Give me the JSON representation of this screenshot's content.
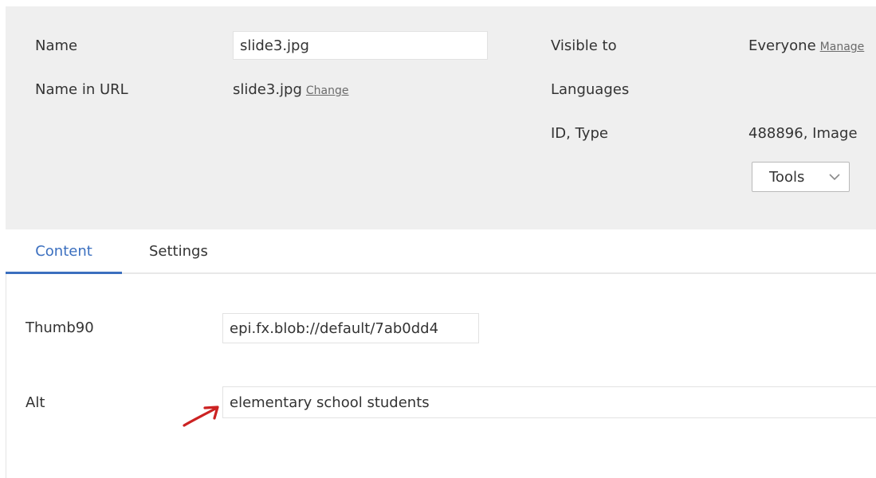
{
  "header": {
    "name_label": "Name",
    "name_value": "slide3.jpg",
    "name_in_url_label": "Name in URL",
    "name_in_url_value": "slide3.jpg",
    "change_link": "Change",
    "visible_to_label": "Visible to",
    "visible_to_value": "Everyone",
    "manage_link": "Manage",
    "languages_label": "Languages",
    "id_type_label": "ID, Type",
    "id_type_value": "488896, Image",
    "tools_label": "Tools"
  },
  "tabs": [
    {
      "label": "Content",
      "active": true
    },
    {
      "label": "Settings",
      "active": false
    }
  ],
  "fields": {
    "thumb90_label": "Thumb90",
    "thumb90_value": "epi.fx.blob://default/7ab0dd4",
    "alt_label": "Alt",
    "alt_value": "elementary school students"
  },
  "colors": {
    "active_tab": "#3b6fbf",
    "panel_background": "#efefef",
    "annotation_arrow": "#cc2222"
  },
  "icons": {
    "tools_dropdown": "chevron-down-icon",
    "annotation": "red-arrow-icon"
  }
}
